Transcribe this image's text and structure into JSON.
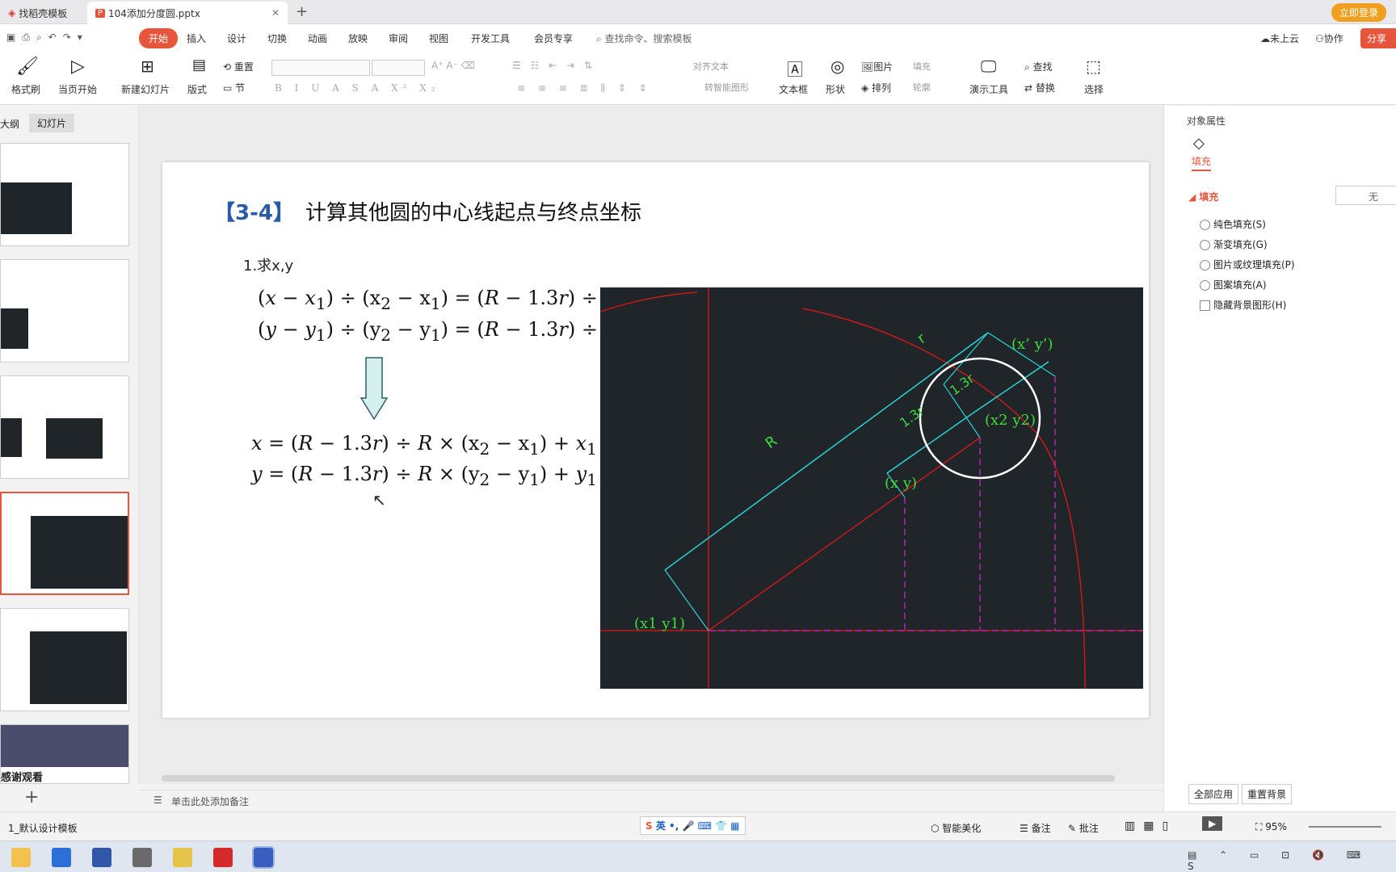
{
  "tabs": {
    "tab1": "找稻壳模板",
    "tab2": "104添加分度圆.pptx",
    "new_tab": "+"
  },
  "login": {
    "label": "立即登录"
  },
  "menu": {
    "items": [
      "开始",
      "插入",
      "设计",
      "切换",
      "动画",
      "放映",
      "审阅",
      "视图",
      "开发工具",
      "会员专享"
    ],
    "search": "查找命令、搜索模板",
    "cloud": "未上云",
    "collab": "协作",
    "share": "分享"
  },
  "ribbon": {
    "format_painter": "格式刷",
    "from_current": "当页开始",
    "new_slide": "新建幻灯片",
    "layout": "版式",
    "reset": "重置",
    "section": "节",
    "align_text": "对齐文本",
    "smart_art": "转智能图形",
    "textbox": "文本框",
    "shape": "形状",
    "picture": "图片",
    "arrange": "排列",
    "fill": "填充",
    "outline": "轮廓",
    "presenter": "演示工具",
    "find": "查找",
    "replace": "替换",
    "select": "选择"
  },
  "left_panel": {
    "tab_outline": "大纲",
    "tab_slides": "幻灯片",
    "last_slide_text": "感谢观看"
  },
  "slide": {
    "title_tag": "【3-4】",
    "title": "计算其他圆的中心线起点与终点坐标",
    "step": "1.求x,y",
    "labels": {
      "r": "r",
      "R": "R",
      "r13a": "1.3r",
      "r13b": "1.3r",
      "xy_top": "(x’ y’)",
      "center": "(x2 y2)",
      "xy": "(x y)",
      "origin": "(x1 y1)"
    }
  },
  "notes": {
    "placeholder": "单击此处添加备注"
  },
  "right_panel": {
    "title": "对象属性",
    "tab_fill": "填充",
    "section": "填充",
    "none": "无",
    "options": [
      "纯色填充(S)",
      "渐变填充(G)",
      "图片或纹理填充(P)",
      "图案填充(A)"
    ],
    "hide_bg": "隐藏背景图形(H)",
    "apply_all": "全部应用",
    "reset_bg": "重置背景"
  },
  "status": {
    "template": "1_默认设计模板",
    "beautify": "智能美化",
    "notes": "备注",
    "comment": "批注",
    "zoom": "95%",
    "ime": "英"
  },
  "colors": {
    "accent": "#e8553d",
    "dark_bg": "#1f2528",
    "cyan": "#2ad4d4",
    "green": "#3ddb3d",
    "red": "#c61a1a",
    "purple": "#b026b0"
  }
}
